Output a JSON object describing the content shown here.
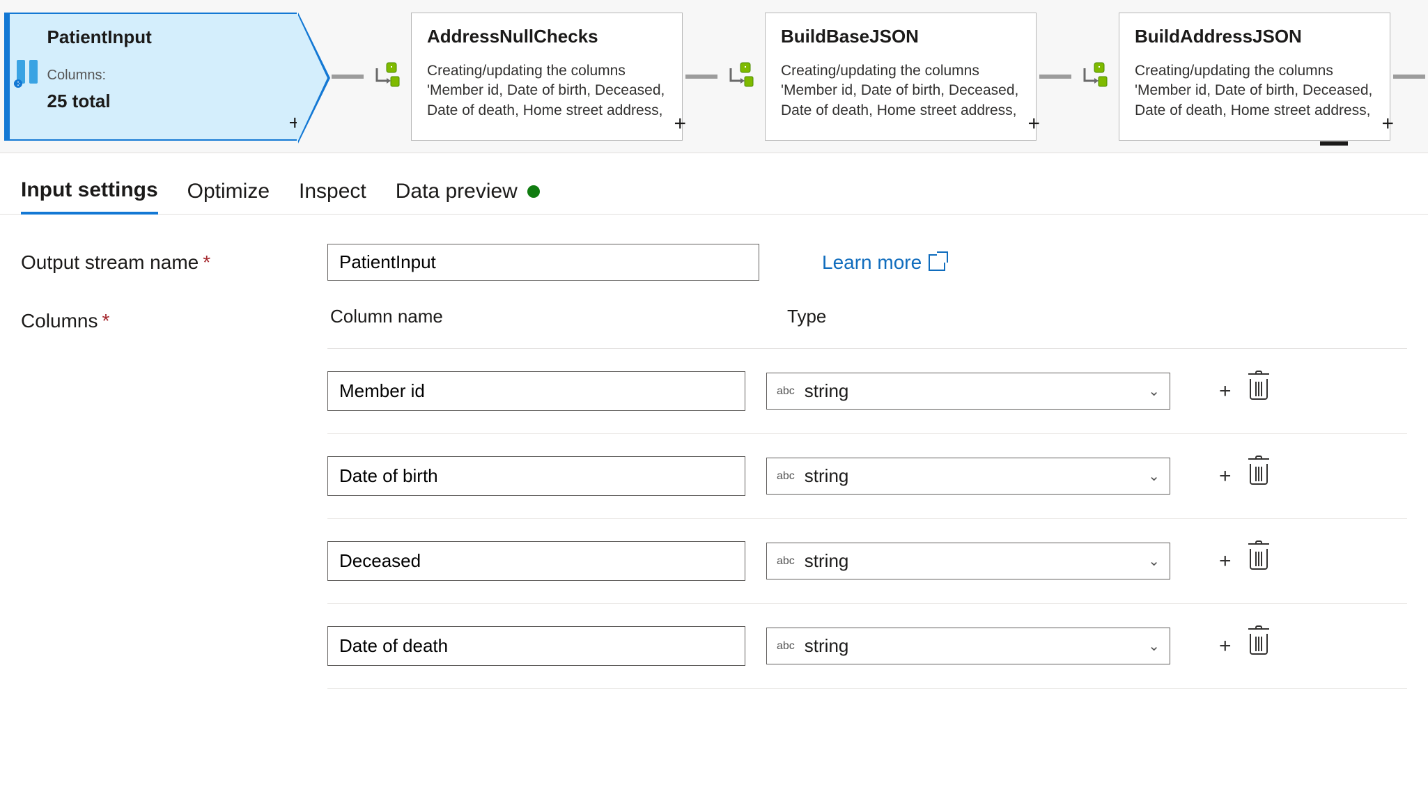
{
  "flow": {
    "nodes": [
      {
        "title": "PatientInput",
        "meta_label": "Columns:",
        "meta_value": "25 total",
        "selected": true,
        "kind": "source"
      },
      {
        "title": "AddressNullChecks",
        "desc": "Creating/updating the columns 'Member id, Date of birth, Deceased, Date of death, Home street address,",
        "kind": "derived"
      },
      {
        "title": "BuildBaseJSON",
        "desc": "Creating/updating the columns 'Member id, Date of birth, Deceased, Date of death, Home street address,",
        "kind": "derived"
      },
      {
        "title": "BuildAddressJSON",
        "desc": "Creating/updating the columns 'Member id, Date of birth, Deceased, Date of death, Home street address,",
        "kind": "derived"
      }
    ]
  },
  "tabs": [
    {
      "label": "Input settings",
      "active": true
    },
    {
      "label": "Optimize",
      "active": false
    },
    {
      "label": "Inspect",
      "active": false
    },
    {
      "label": "Data preview",
      "active": false,
      "status": "ok"
    }
  ],
  "form": {
    "output_stream_name_label": "Output stream name",
    "output_stream_name_value": "PatientInput",
    "learn_more": "Learn more",
    "columns_label": "Columns"
  },
  "columns_table": {
    "headers": {
      "name": "Column name",
      "type": "Type"
    },
    "type_prefix": "abc",
    "rows": [
      {
        "name": "Member id",
        "type": "string"
      },
      {
        "name": "Date of birth",
        "type": "string"
      },
      {
        "name": "Deceased",
        "type": "string"
      },
      {
        "name": "Date of death",
        "type": "string"
      }
    ]
  }
}
